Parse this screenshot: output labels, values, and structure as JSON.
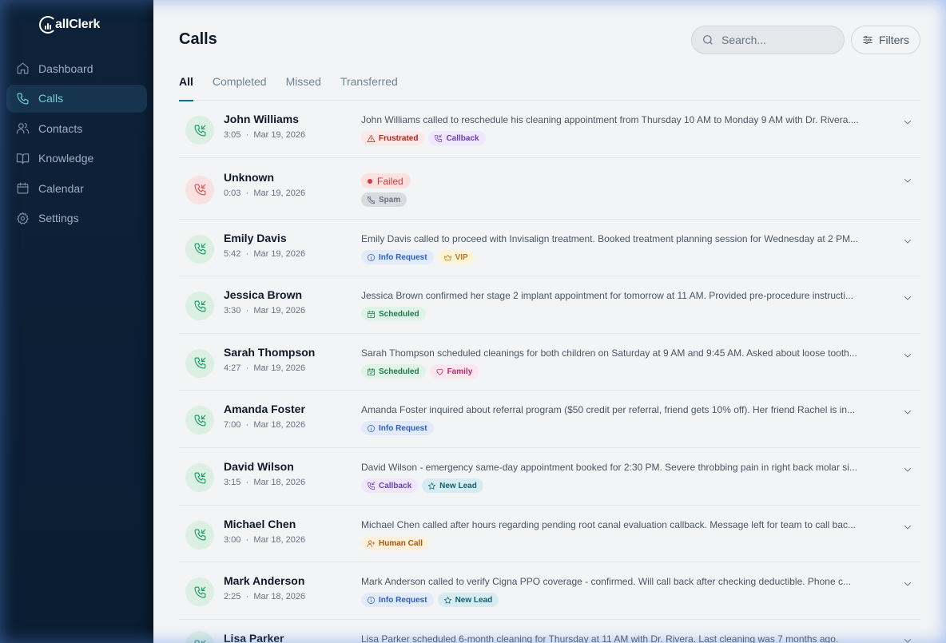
{
  "app": {
    "logo_text": "allClerk"
  },
  "sidebar": {
    "items": [
      {
        "label": "Dashboard",
        "icon": "home-icon"
      },
      {
        "label": "Calls",
        "icon": "phone-icon",
        "active": true
      },
      {
        "label": "Contacts",
        "icon": "users-icon"
      },
      {
        "label": "Knowledge",
        "icon": "book-icon"
      },
      {
        "label": "Calendar",
        "icon": "calendar-icon"
      },
      {
        "label": "Settings",
        "icon": "gear-icon"
      }
    ]
  },
  "header": {
    "title": "Calls",
    "search_placeholder": "Search...",
    "filters_label": "Filters"
  },
  "tabs": [
    {
      "label": "All",
      "active": true
    },
    {
      "label": "Completed"
    },
    {
      "label": "Missed"
    },
    {
      "label": "Transferred"
    }
  ],
  "calls": [
    {
      "name": "John Williams",
      "duration": "3:05",
      "date": "Mar 19, 2026",
      "status": "completed",
      "summary": "John Williams called to reschedule his cleaning appointment from Thursday 10 AM to Monday 9 AM with Dr. Rivera....",
      "tags": [
        {
          "label": "Frustrated",
          "type": "frustrated",
          "icon": "warning-icon"
        },
        {
          "label": "Callback",
          "type": "callback",
          "icon": "phone-callback-icon"
        }
      ]
    },
    {
      "name": "Unknown",
      "duration": "0:03",
      "date": "Mar 19, 2026",
      "status": "missed",
      "status_label": "Failed",
      "summary": "",
      "tags": [
        {
          "label": "Spam",
          "type": "spam",
          "icon": "phone-off-icon"
        }
      ]
    },
    {
      "name": "Emily Davis",
      "duration": "5:42",
      "date": "Mar 19, 2026",
      "status": "completed",
      "summary": "Emily Davis called to proceed with Invisalign treatment. Booked treatment planning session for Wednesday at 2 PM...",
      "tags": [
        {
          "label": "Info Request",
          "type": "info",
          "icon": "info-icon"
        },
        {
          "label": "VIP",
          "type": "vip",
          "icon": "crown-icon"
        }
      ]
    },
    {
      "name": "Jessica Brown",
      "duration": "3:30",
      "date": "Mar 19, 2026",
      "status": "completed",
      "summary": "Jessica Brown confirmed her stage 2 implant appointment for tomorrow at 11 AM. Provided pre-procedure instructi...",
      "tags": [
        {
          "label": "Scheduled",
          "type": "scheduled",
          "icon": "calendar-check-icon"
        }
      ]
    },
    {
      "name": "Sarah Thompson",
      "duration": "4:27",
      "date": "Mar 19, 2026",
      "status": "completed",
      "summary": "Sarah Thompson scheduled cleanings for both children on Saturday at 9 AM and 9:45 AM. Asked about loose tooth...",
      "tags": [
        {
          "label": "Scheduled",
          "type": "scheduled",
          "icon": "calendar-check-icon"
        },
        {
          "label": "Family",
          "type": "family",
          "icon": "heart-icon"
        }
      ]
    },
    {
      "name": "Amanda Foster",
      "duration": "7:00",
      "date": "Mar 18, 2026",
      "status": "completed",
      "summary": "Amanda Foster inquired about referral program ($50 credit per referral, friend gets 10% off). Her friend Rachel is in...",
      "tags": [
        {
          "label": "Info Request",
          "type": "info",
          "icon": "info-icon"
        }
      ]
    },
    {
      "name": "David Wilson",
      "duration": "3:15",
      "date": "Mar 18, 2026",
      "status": "completed",
      "summary": "David Wilson - emergency same-day appointment booked for 2:30 PM. Severe throbbing pain in right back molar si...",
      "tags": [
        {
          "label": "Callback",
          "type": "callback",
          "icon": "phone-callback-icon"
        },
        {
          "label": "New Lead",
          "type": "newlead",
          "icon": "star-icon"
        }
      ]
    },
    {
      "name": "Michael Chen",
      "duration": "3:00",
      "date": "Mar 18, 2026",
      "status": "completed",
      "summary": "Michael Chen called after hours regarding pending root canal evaluation callback. Message left for team to call bac...",
      "tags": [
        {
          "label": "Human Call",
          "type": "human",
          "icon": "user-plus-icon"
        }
      ]
    },
    {
      "name": "Mark Anderson",
      "duration": "2:25",
      "date": "Mar 18, 2026",
      "status": "completed",
      "summary": "Mark Anderson called to verify Cigna PPO coverage - confirmed. Will call back after checking deductible. Phone c...",
      "tags": [
        {
          "label": "Info Request",
          "type": "info",
          "icon": "info-icon"
        },
        {
          "label": "New Lead",
          "type": "newlead",
          "icon": "star-icon"
        }
      ]
    },
    {
      "name": "Lisa Parker",
      "duration": "",
      "date": "",
      "status": "completed",
      "summary": "Lisa Parker scheduled 6-month cleaning for Thursday at 11 AM with Dr. Rivera. Last cleaning was 7 months ago.",
      "tags": []
    }
  ]
}
